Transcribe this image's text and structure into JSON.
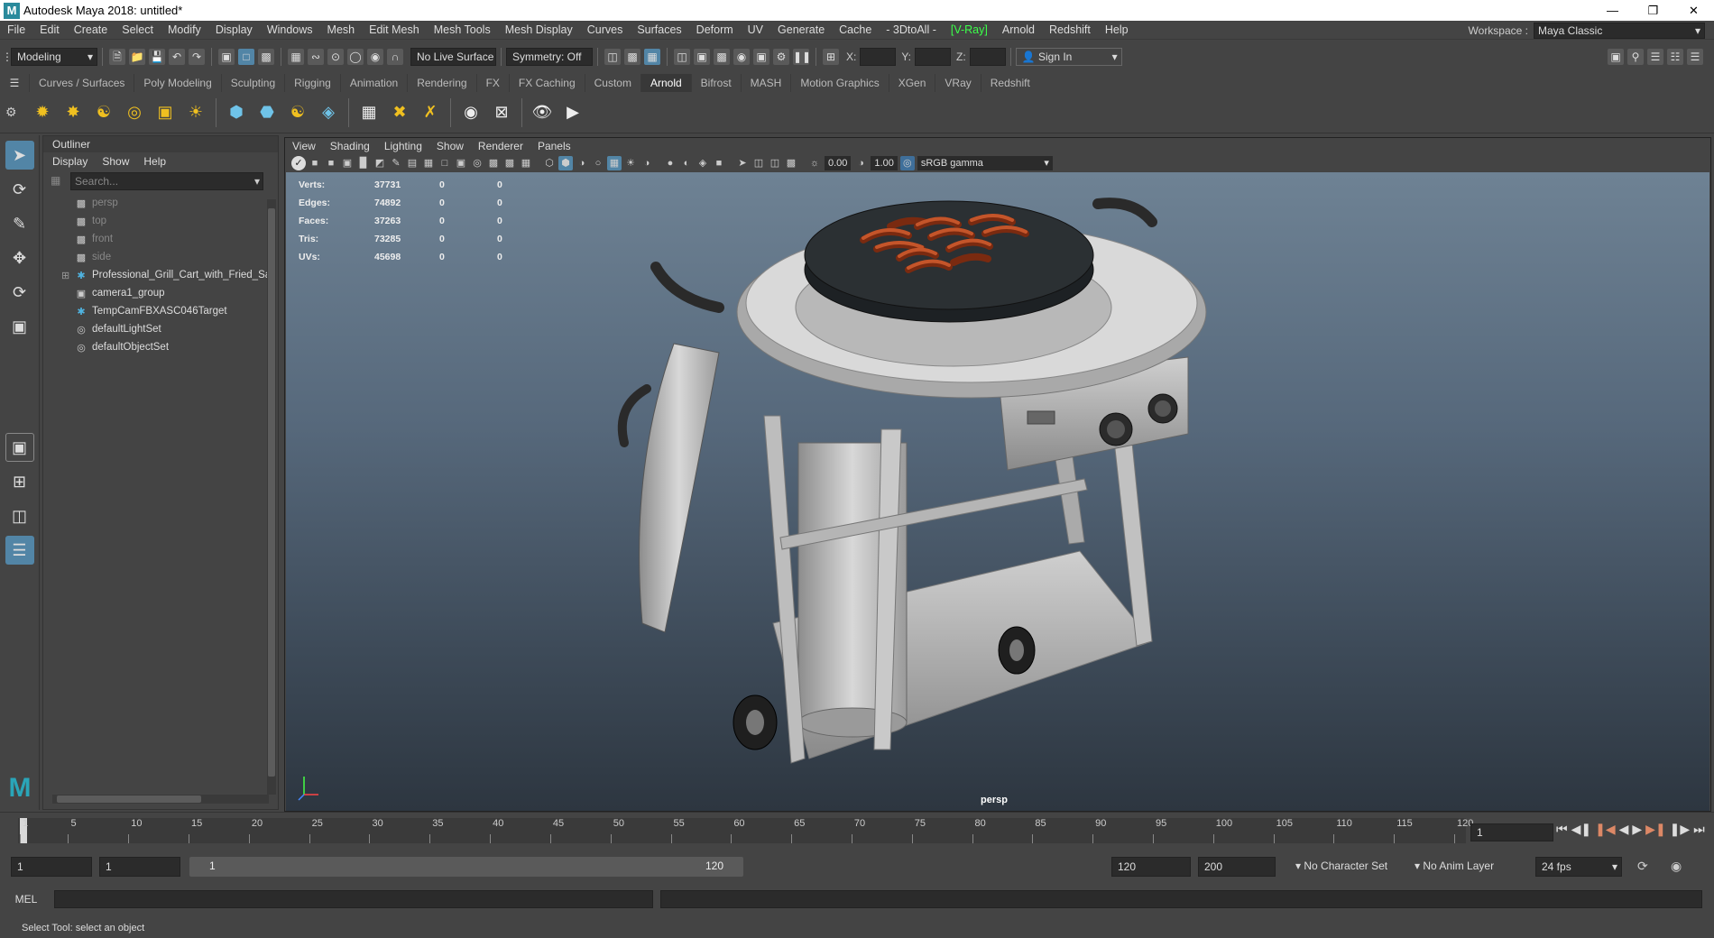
{
  "window": {
    "title": "Autodesk Maya 2018: untitled*"
  },
  "menubar": [
    "File",
    "Edit",
    "Create",
    "Select",
    "Modify",
    "Display",
    "Windows",
    "Mesh",
    "Edit Mesh",
    "Mesh Tools",
    "Mesh Display",
    "Curves",
    "Surfaces",
    "Deform",
    "UV",
    "Generate",
    "Cache",
    "- 3DtoAll -",
    "[V-Ray]",
    "Arnold",
    "Redshift",
    "Help"
  ],
  "workspace": {
    "label": "Workspace :",
    "value": "Maya Classic"
  },
  "statusline": {
    "mode": "Modeling",
    "live_surface": "No Live Surface",
    "symmetry": "Symmetry: Off",
    "x_label": "X:",
    "y_label": "Y:",
    "z_label": "Z:",
    "sign_in": "Sign In"
  },
  "shelf_tabs": [
    "Curves / Surfaces",
    "Poly Modeling",
    "Sculpting",
    "Rigging",
    "Animation",
    "Rendering",
    "FX",
    "FX Caching",
    "Custom",
    "Arnold",
    "Bifrost",
    "MASH",
    "Motion Graphics",
    "XGen",
    "VRay",
    "Redshift"
  ],
  "active_shelf": "Arnold",
  "outliner": {
    "title": "Outliner",
    "menu": [
      "Display",
      "Show",
      "Help"
    ],
    "search_placeholder": "Search...",
    "items": [
      {
        "name": "persp",
        "icon": "camera-icon",
        "dim": true
      },
      {
        "name": "top",
        "icon": "camera-icon",
        "dim": true
      },
      {
        "name": "front",
        "icon": "camera-icon",
        "dim": true
      },
      {
        "name": "side",
        "icon": "camera-icon",
        "dim": true
      },
      {
        "name": "Professional_Grill_Cart_with_Fried_Sa",
        "icon": "transform-icon",
        "expandable": true
      },
      {
        "name": "camera1_group",
        "icon": "group-icon"
      },
      {
        "name": "TempCamFBXASC046Target",
        "icon": "transform-icon"
      },
      {
        "name": "defaultLightSet",
        "icon": "set-icon"
      },
      {
        "name": "defaultObjectSet",
        "icon": "set-icon"
      }
    ]
  },
  "viewport": {
    "menu": [
      "View",
      "Shading",
      "Lighting",
      "Show",
      "Renderer",
      "Panels"
    ],
    "exposure": "0.00",
    "gamma": "1.00",
    "color_space": "sRGB gamma",
    "camera_label": "persp",
    "hud": [
      {
        "label": "Verts:",
        "value": "37731",
        "sel": "0",
        "comp": "0"
      },
      {
        "label": "Edges:",
        "value": "74892",
        "sel": "0",
        "comp": "0"
      },
      {
        "label": "Faces:",
        "value": "37263",
        "sel": "0",
        "comp": "0"
      },
      {
        "label": "Tris:",
        "value": "73285",
        "sel": "0",
        "comp": "0"
      },
      {
        "label": "UVs:",
        "value": "45698",
        "sel": "0",
        "comp": "0"
      }
    ]
  },
  "timeline": {
    "ticks": [
      "1",
      "5",
      "10",
      "15",
      "20",
      "25",
      "30",
      "35",
      "40",
      "45",
      "50",
      "55",
      "60",
      "65",
      "70",
      "75",
      "80",
      "85",
      "90",
      "95",
      "100",
      "105",
      "110",
      "115",
      "120"
    ],
    "current_frame": "1"
  },
  "range": {
    "start": "1",
    "playback_start": "1",
    "slider_start": "1",
    "slider_end": "120",
    "playback_end": "120",
    "end": "200",
    "character_set": "No Character Set",
    "anim_layer": "No Anim Layer",
    "fps": "24 fps"
  },
  "command": {
    "label": "MEL"
  },
  "help_line": "Select Tool: select an object",
  "colors": {
    "accent": "#5285a6",
    "vray": "#3bff4a"
  }
}
